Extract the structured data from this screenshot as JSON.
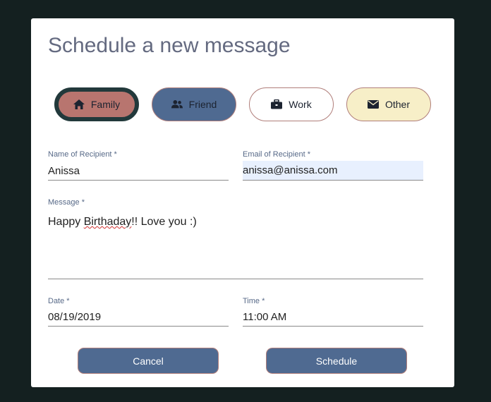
{
  "dialog": {
    "title": "Schedule a new message"
  },
  "categories": [
    {
      "label": "Family",
      "icon": "home-icon",
      "selected": true
    },
    {
      "label": "Friend",
      "icon": "users-icon",
      "selected": false
    },
    {
      "label": "Work",
      "icon": "briefcase-icon",
      "selected": false
    },
    {
      "label": "Other",
      "icon": "envelope-icon",
      "selected": false
    }
  ],
  "form": {
    "recipient_name": {
      "label": "Name of Recipient *",
      "value": "Anissa"
    },
    "recipient_email": {
      "label": "Email of Recipient *",
      "value": "anissa@anissa.com"
    },
    "message": {
      "label": "Message *",
      "value_pre": "Happy ",
      "value_misspelled": "Birthaday",
      "value_post": "!! Love you :)"
    },
    "date": {
      "label": "Date *",
      "value": "08/19/2019"
    },
    "time": {
      "label": "Time *",
      "value": "11:00 AM"
    }
  },
  "buttons": {
    "cancel": "Cancel",
    "schedule": "Schedule"
  },
  "colors": {
    "family": "#b8756f",
    "friend": "#4f6a91",
    "work": "#ffffff",
    "other": "#f7efc8",
    "button": "#4f6a91",
    "backdrop": "#142020"
  }
}
